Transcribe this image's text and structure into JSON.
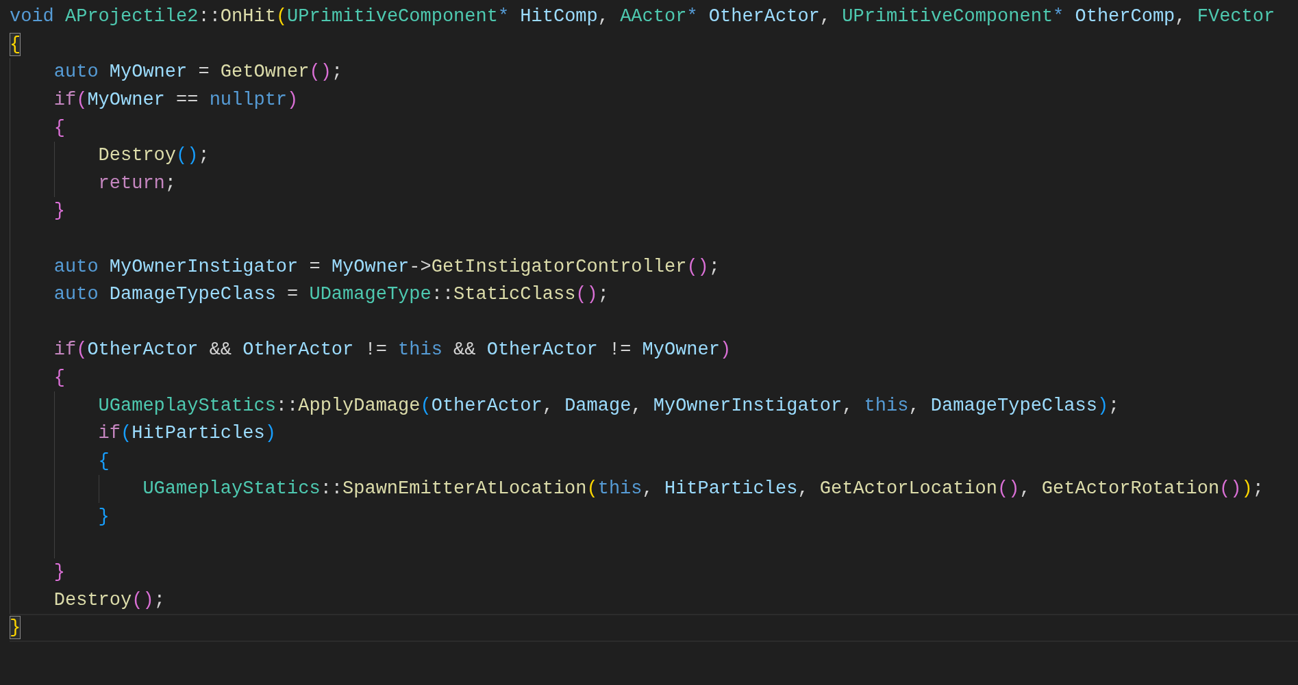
{
  "editor": {
    "lines": [
      {
        "kind": "code",
        "current": false,
        "tokens": [
          {
            "text": "void",
            "kind": "keyword"
          },
          {
            "text": " AProjectile2",
            "kind": "type"
          },
          {
            "text": "::",
            "kind": "punct"
          },
          {
            "text": "OnHit",
            "kind": "function"
          },
          {
            "text": "(",
            "kind": "bracket-1"
          },
          {
            "text": "UPrimitiveComponent",
            "kind": "type"
          },
          {
            "text": "*",
            "kind": "keyword"
          },
          {
            "text": " HitComp",
            "kind": "variable"
          },
          {
            "text": ",",
            "kind": "punct"
          },
          {
            "text": " AActor",
            "kind": "type"
          },
          {
            "text": "*",
            "kind": "keyword"
          },
          {
            "text": " OtherActor",
            "kind": "variable"
          },
          {
            "text": ",",
            "kind": "punct"
          },
          {
            "text": " UPrimitiveComponent",
            "kind": "type"
          },
          {
            "text": "*",
            "kind": "keyword"
          },
          {
            "text": " OtherComp",
            "kind": "variable"
          },
          {
            "text": ",",
            "kind": "punct"
          },
          {
            "text": " FVector",
            "kind": "type"
          }
        ]
      },
      {
        "kind": "code",
        "current": false,
        "tokens": [
          {
            "text": "{",
            "kind": "bracket-1",
            "matched": true
          }
        ],
        "children": [
          {
            "kind": "code",
            "current": false,
            "tokens": [
              {
                "text": "auto",
                "kind": "keyword"
              },
              {
                "text": " MyOwner",
                "kind": "variable"
              },
              {
                "text": " = ",
                "kind": "punct"
              },
              {
                "text": "GetOwner",
                "kind": "function"
              },
              {
                "text": "(",
                "kind": "bracket-2"
              },
              {
                "text": ")",
                "kind": "bracket-2"
              },
              {
                "text": ";",
                "kind": "punct"
              }
            ]
          },
          {
            "kind": "code",
            "current": false,
            "tokens": [
              {
                "text": "if",
                "kind": "control"
              },
              {
                "text": "(",
                "kind": "bracket-2"
              },
              {
                "text": "MyOwner",
                "kind": "variable"
              },
              {
                "text": " == ",
                "kind": "punct"
              },
              {
                "text": "nullptr",
                "kind": "keyword"
              },
              {
                "text": ")",
                "kind": "bracket-2"
              }
            ]
          },
          {
            "kind": "code",
            "current": false,
            "tokens": [
              {
                "text": "{",
                "kind": "bracket-2",
                "matched": false
              }
            ],
            "children": [
              {
                "kind": "code",
                "current": false,
                "tokens": [
                  {
                    "text": "Destroy",
                    "kind": "function"
                  },
                  {
                    "text": "(",
                    "kind": "bracket-3"
                  },
                  {
                    "text": ")",
                    "kind": "bracket-3"
                  },
                  {
                    "text": ";",
                    "kind": "punct"
                  }
                ]
              },
              {
                "kind": "code",
                "current": false,
                "tokens": [
                  {
                    "text": "return",
                    "kind": "control"
                  },
                  {
                    "text": ";",
                    "kind": "punct"
                  }
                ]
              }
            ]
          },
          {
            "kind": "code",
            "current": false,
            "tokens": [
              {
                "text": "}",
                "kind": "bracket-2",
                "matched": false
              }
            ]
          },
          {
            "kind": "blank",
            "current": false
          },
          {
            "kind": "code",
            "current": false,
            "tokens": [
              {
                "text": "auto",
                "kind": "keyword"
              },
              {
                "text": " MyOwnerInstigator",
                "kind": "variable"
              },
              {
                "text": " = ",
                "kind": "punct"
              },
              {
                "text": "MyOwner",
                "kind": "variable"
              },
              {
                "text": "->",
                "kind": "punct"
              },
              {
                "text": "GetInstigatorController",
                "kind": "function"
              },
              {
                "text": "(",
                "kind": "bracket-2"
              },
              {
                "text": ")",
                "kind": "bracket-2"
              },
              {
                "text": ";",
                "kind": "punct"
              }
            ]
          },
          {
            "kind": "code",
            "current": false,
            "tokens": [
              {
                "text": "auto",
                "kind": "keyword"
              },
              {
                "text": " DamageTypeClass",
                "kind": "variable"
              },
              {
                "text": " = ",
                "kind": "punct"
              },
              {
                "text": "UDamageType",
                "kind": "type"
              },
              {
                "text": "::",
                "kind": "punct"
              },
              {
                "text": "StaticClass",
                "kind": "function"
              },
              {
                "text": "(",
                "kind": "bracket-2"
              },
              {
                "text": ")",
                "kind": "bracket-2"
              },
              {
                "text": ";",
                "kind": "punct"
              }
            ]
          },
          {
            "kind": "blank",
            "current": false
          },
          {
            "kind": "code",
            "current": false,
            "tokens": [
              {
                "text": "if",
                "kind": "control"
              },
              {
                "text": "(",
                "kind": "bracket-2"
              },
              {
                "text": "OtherActor",
                "kind": "variable"
              },
              {
                "text": " && ",
                "kind": "punct"
              },
              {
                "text": "OtherActor",
                "kind": "variable"
              },
              {
                "text": " != ",
                "kind": "punct"
              },
              {
                "text": "this",
                "kind": "keyword"
              },
              {
                "text": " && ",
                "kind": "punct"
              },
              {
                "text": "OtherActor",
                "kind": "variable"
              },
              {
                "text": " != ",
                "kind": "punct"
              },
              {
                "text": "MyOwner",
                "kind": "variable"
              },
              {
                "text": ")",
                "kind": "bracket-2"
              }
            ]
          },
          {
            "kind": "code",
            "current": false,
            "tokens": [
              {
                "text": "{",
                "kind": "bracket-2",
                "matched": false
              }
            ],
            "children": [
              {
                "kind": "code",
                "current": false,
                "tokens": [
                  {
                    "text": "UGameplayStatics",
                    "kind": "type"
                  },
                  {
                    "text": "::",
                    "kind": "punct"
                  },
                  {
                    "text": "ApplyDamage",
                    "kind": "function"
                  },
                  {
                    "text": "(",
                    "kind": "bracket-3"
                  },
                  {
                    "text": "OtherActor",
                    "kind": "variable"
                  },
                  {
                    "text": ", ",
                    "kind": "punct"
                  },
                  {
                    "text": "Damage",
                    "kind": "variable"
                  },
                  {
                    "text": ", ",
                    "kind": "punct"
                  },
                  {
                    "text": "MyOwnerInstigator",
                    "kind": "variable"
                  },
                  {
                    "text": ", ",
                    "kind": "punct"
                  },
                  {
                    "text": "this",
                    "kind": "keyword"
                  },
                  {
                    "text": ", ",
                    "kind": "punct"
                  },
                  {
                    "text": "DamageTypeClass",
                    "kind": "variable"
                  },
                  {
                    "text": ")",
                    "kind": "bracket-3"
                  },
                  {
                    "text": ";",
                    "kind": "punct"
                  }
                ]
              },
              {
                "kind": "code",
                "current": false,
                "tokens": [
                  {
                    "text": "if",
                    "kind": "control"
                  },
                  {
                    "text": "(",
                    "kind": "bracket-3"
                  },
                  {
                    "text": "HitParticles",
                    "kind": "variable"
                  },
                  {
                    "text": ")",
                    "kind": "bracket-3"
                  }
                ]
              },
              {
                "kind": "code",
                "current": false,
                "tokens": [
                  {
                    "text": "{",
                    "kind": "bracket-3",
                    "matched": false
                  }
                ],
                "children": [
                  {
                    "kind": "code",
                    "current": false,
                    "tokens": [
                      {
                        "text": "UGameplayStatics",
                        "kind": "type"
                      },
                      {
                        "text": "::",
                        "kind": "punct"
                      },
                      {
                        "text": "SpawnEmitterAtLocation",
                        "kind": "function"
                      },
                      {
                        "text": "(",
                        "kind": "bracket-1"
                      },
                      {
                        "text": "this",
                        "kind": "keyword"
                      },
                      {
                        "text": ", ",
                        "kind": "punct"
                      },
                      {
                        "text": "HitParticles",
                        "kind": "variable"
                      },
                      {
                        "text": ", ",
                        "kind": "punct"
                      },
                      {
                        "text": "GetActorLocation",
                        "kind": "function"
                      },
                      {
                        "text": "(",
                        "kind": "bracket-2"
                      },
                      {
                        "text": ")",
                        "kind": "bracket-2"
                      },
                      {
                        "text": ", ",
                        "kind": "punct"
                      },
                      {
                        "text": "GetActorRotation",
                        "kind": "function"
                      },
                      {
                        "text": "(",
                        "kind": "bracket-2"
                      },
                      {
                        "text": ")",
                        "kind": "bracket-2"
                      },
                      {
                        "text": ")",
                        "kind": "bracket-1"
                      },
                      {
                        "text": ";",
                        "kind": "punct"
                      }
                    ]
                  }
                ]
              },
              {
                "kind": "code",
                "current": false,
                "tokens": [
                  {
                    "text": "}",
                    "kind": "bracket-3",
                    "matched": false
                  }
                ]
              },
              {
                "kind": "blank",
                "current": false
              }
            ]
          },
          {
            "kind": "code",
            "current": false,
            "tokens": [
              {
                "text": "}",
                "kind": "bracket-2",
                "matched": false
              }
            ]
          },
          {
            "kind": "code",
            "current": false,
            "tokens": [
              {
                "text": "Destroy",
                "kind": "function"
              },
              {
                "text": "(",
                "kind": "bracket-2"
              },
              {
                "text": ")",
                "kind": "bracket-2"
              },
              {
                "text": ";",
                "kind": "punct"
              }
            ]
          }
        ]
      },
      {
        "kind": "code",
        "current": true,
        "tokens": [
          {
            "text": "}",
            "kind": "bracket-1",
            "matched": true
          }
        ]
      }
    ]
  }
}
